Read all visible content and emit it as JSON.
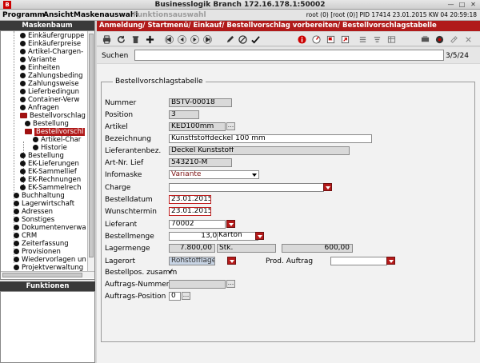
{
  "window": {
    "title": "Businesslogik Branch 172.16.178.1:50002",
    "logo": "B"
  },
  "menubar": {
    "items": [
      "Programm",
      "Ansicht",
      "Maskenauswahl",
      "Funktionsauswahl"
    ],
    "status": "root (0) [root (0)] PID 17414   23.01.2015 KW  04  20:59:18"
  },
  "left": {
    "header": "Maskenbaum",
    "functions_header": "Funktionen",
    "tree": [
      "Einkäufergruppe",
      "Einkäuferpreise",
      "Artikel-Chargen-",
      "Variante",
      "Einheiten",
      "Zahlungsbeding",
      "Zahlungsweise",
      "Lieferbedingun",
      "Container-Verw",
      "Anfragen",
      "Bestellvorschlag",
      "Bestellung",
      "Bestellvorschl",
      "Artikel-Char",
      "Historie",
      "Bestellung",
      "EK-Lieferungen",
      "EK-Sammellief",
      "EK-Rechnungen",
      "EK-Sammelrech",
      "Buchhaltung",
      "Lagerwirtschaft",
      "Adressen",
      "Sonstiges",
      "Dokumentenverwa",
      "CRM",
      "Zeiterfassung",
      "Provisionen",
      "Wiedervorlagen un",
      "Projektverwaltung"
    ]
  },
  "breadcrumb": "Anmeldung/ Startmenü/ Einkauf/ Bestellvorschlag vorbereiten/ Bestellvorschlagstabelle",
  "search": {
    "label": "Suchen",
    "value": "",
    "count": "3/5/24"
  },
  "form": {
    "group_title": "Bestellvorschlagstabelle",
    "fields": {
      "nummer": {
        "label": "Nummer",
        "value": "BSTV-00018"
      },
      "position": {
        "label": "Position",
        "value": "3"
      },
      "artikel": {
        "label": "Artikel",
        "value": "KED100mm"
      },
      "bezeichnung": {
        "label": "Bezeichnung",
        "value": "Kunstfstoffdeckel 100 mm"
      },
      "lieferantenbez": {
        "label": "Lieferantenbez.",
        "value": "Deckel Kunststoff"
      },
      "artnr_lief": {
        "label": "Art-Nr. Lief",
        "value": "543210-M"
      },
      "infomaske": {
        "label": "Infomaske",
        "value": "Variante"
      },
      "charge": {
        "label": "Charge",
        "value": ""
      },
      "bestelldatum": {
        "label": "Bestelldatum",
        "value": "23.01.2015"
      },
      "wunschtermin": {
        "label": "Wunschtermin",
        "value": "23.01.2015"
      },
      "lieferant": {
        "label": "Lieferant",
        "value": "70002"
      },
      "bestellmenge": {
        "label": "Bestellmenge",
        "value": "13,00",
        "unit": "Karton"
      },
      "lagermenge": {
        "label": "Lagermenge",
        "value": "7.800,00",
        "unit": "Stk.",
        "extra": "600,00"
      },
      "lagerort": {
        "label": "Lagerort",
        "value": "Rohstofflager"
      },
      "prod_auftrag": {
        "label": "Prod. Auftrag",
        "value": ""
      },
      "bestellpos": {
        "label": "Bestellpos. zusamm",
        "check": "✓"
      },
      "auftrags_nummer": {
        "label": "Auftrags-Nummer",
        "value": ""
      },
      "auftrags_position": {
        "label": "Auftrags-Position",
        "value": "0"
      }
    }
  },
  "toolbar_icons": [
    "print-icon",
    "refresh-icon",
    "delete-icon",
    "add-icon",
    "first-icon",
    "prev-icon",
    "next-icon",
    "last-icon",
    "edit-icon",
    "cancel-icon",
    "save-icon",
    "info-icon",
    "target-icon",
    "flag-icon",
    "export-icon",
    "list-icon",
    "filter-icon",
    "table-icon",
    "settings-icon",
    "attach-icon",
    "close-icon"
  ]
}
